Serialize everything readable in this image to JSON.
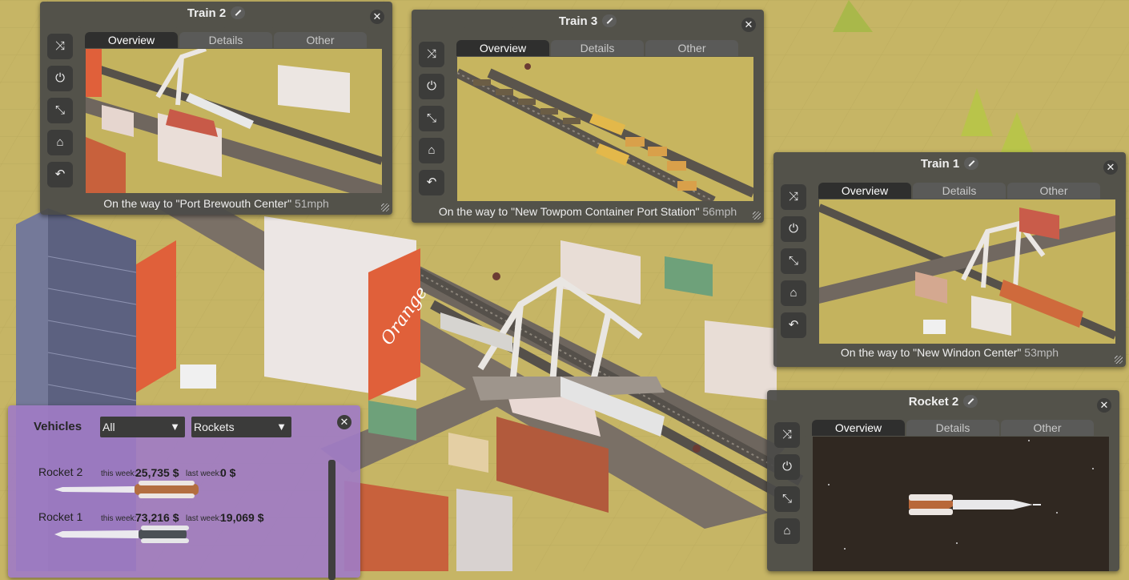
{
  "windows": [
    {
      "title": "Train 2",
      "tabs": [
        "Overview",
        "Details",
        "Other"
      ],
      "status_text": "On the way to \"Port Brewouth Center\"",
      "speed": "51mph"
    },
    {
      "title": "Train 3",
      "tabs": [
        "Overview",
        "Details",
        "Other"
      ],
      "status_text": "On the way to \"New Towpom Container Port Station\"",
      "speed": "56mph"
    },
    {
      "title": "Train 1",
      "tabs": [
        "Overview",
        "Details",
        "Other"
      ],
      "status_text": "On the way to \"New Windon Center\"",
      "speed": "53mph"
    },
    {
      "title": "Rocket 2",
      "tabs": [
        "Overview",
        "Details",
        "Other"
      ]
    }
  ],
  "side_icons": [
    "shuffle-icon",
    "power-icon",
    "collapse-icon",
    "depot-icon",
    "undo-icon"
  ],
  "vehicles_panel": {
    "title": "Vehicles",
    "filter_primary": "All",
    "filter_type": "Rockets",
    "rows": [
      {
        "name": "Rocket 2",
        "this_week_label": "this week:",
        "this_week": "25,735 $",
        "last_week_label": "last week:",
        "last_week": "0 $"
      },
      {
        "name": "Rocket 1",
        "this_week_label": "this week:",
        "this_week": "73,216 $",
        "last_week_label": "last week:",
        "last_week": "19,069 $"
      }
    ]
  },
  "billboard_text": "Orange",
  "colors": {
    "panel": "#4a4a48",
    "tab_active": "#2f2f2e",
    "vehicles_bg": "#a07cc4",
    "terrain": "#c6b565"
  }
}
